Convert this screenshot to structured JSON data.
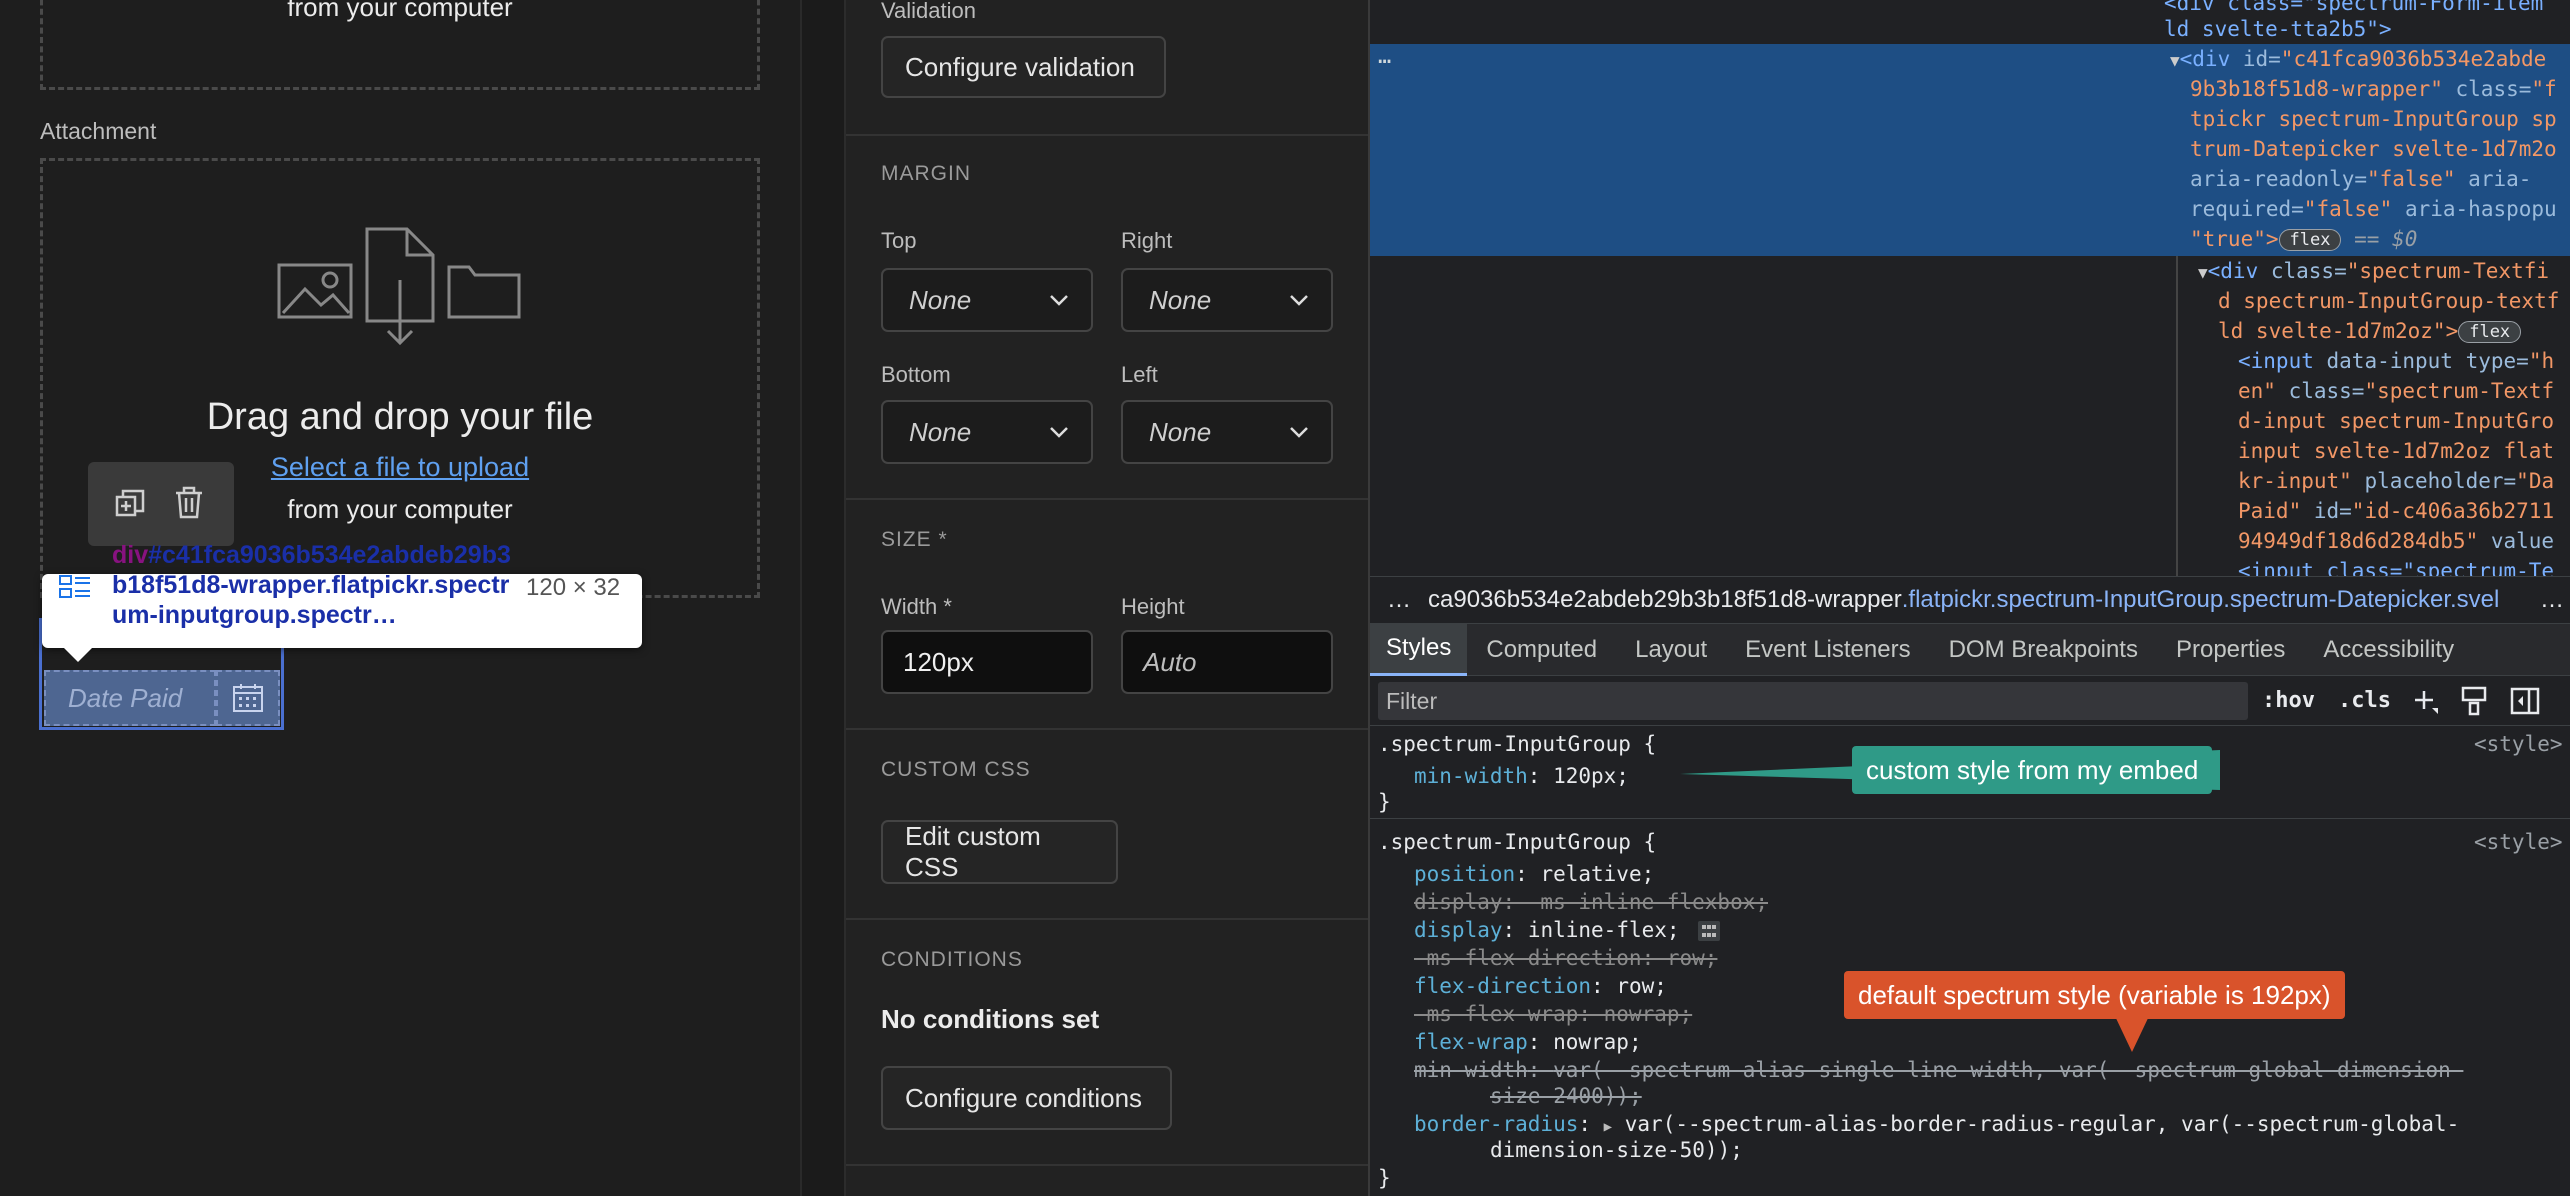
{
  "canvas": {
    "upload_top": {
      "from_computer": "from your computer"
    },
    "attachment_label": "Attachment",
    "upload": {
      "title": "Drag and drop your file",
      "link": "Select a file to upload",
      "from_computer": "from your computer"
    },
    "tooltip": {
      "tag": "div",
      "selector": "#c41fca9036b534e2abdeb29b3b18f51d8-wrapper.flatpickr.spectrum-inputgroup.spectr…",
      "size": "120 × 32"
    },
    "date_field": {
      "placeholder": "Date Paid"
    }
  },
  "settings": {
    "validation": {
      "label": "Validation",
      "button": "Configure validation"
    },
    "margin": {
      "heading": "MARGIN",
      "top": {
        "label": "Top",
        "value": "None"
      },
      "right": {
        "label": "Right",
        "value": "None"
      },
      "bottom": {
        "label": "Bottom",
        "value": "None"
      },
      "left": {
        "label": "Left",
        "value": "None"
      }
    },
    "size": {
      "heading": "SIZE *",
      "width": {
        "label": "Width *",
        "value": "120px"
      },
      "height": {
        "label": "Height",
        "placeholder": "Auto"
      }
    },
    "custom_css": {
      "heading": "CUSTOM CSS",
      "button": "Edit custom CSS"
    },
    "conditions": {
      "heading": "CONDITIONS",
      "status": "No conditions set",
      "button": "Configure conditions"
    }
  },
  "devtools": {
    "dom": {
      "l0a": "<div class=\"spectrum-Form-item",
      "l0b": "ld svelte-tta2b5\">",
      "ellipsis": "…",
      "l1_tag": "<div ",
      "l1_attr": "id=",
      "l1_val": "\"c41fca9036b534e2abde",
      "l2_val": "9b3b18f51d8-wrapper\"",
      "l2_attr": " class=",
      "l2_val2": "\"f",
      "l3": "tpickr spectrum-InputGroup sp",
      "l4": "trum-Datepicker svelte-1d7m2o",
      "l5_attr": "aria-readonly=",
      "l5_val": "\"false\"",
      "l5_attr2": " aria-",
      "l6_attr": "required=",
      "l6_val": "\"false\"",
      "l6_attr2": " aria-haspopu",
      "l7_val": "\"true\">",
      "l7_badge": "flex",
      "l7_sel": "== $0",
      "l8_tag": "<div ",
      "l8_attr": "class=",
      "l8_val": "\"spectrum-Textfi",
      "l9": "d spectrum-InputGroup-textf",
      "l10": "ld svelte-1d7m2oz\">",
      "l10_badge": "flex",
      "l11_tag": "<input ",
      "l11_attr": "data-input type=",
      "l11_val": "\"h",
      "l12_val": "en\"",
      "l12_attr": " class=",
      "l12_val2": "\"spectrum-Textf",
      "l13": "d-input spectrum-InputGro",
      "l14": "input svelte-1d7m2oz flat",
      "l15_val": "kr-input\"",
      "l15_attr": " placeholder=",
      "l15_val2": "\"Da",
      "l16_val": "Paid\"",
      "l16_attr": " id=",
      "l16_val2": "\"id-c406a36b2711",
      "l17_val": "94949df18d6d284db5\"",
      "l17_attr": " value",
      "l18": "<input class=\"spectrum-Te"
    },
    "breadcrumb": {
      "dots": "…",
      "id": "ca9036b534e2abdeb29b3b18f51d8-wrapper",
      "classes": ".flatpickr.spectrum-InputGroup.spectrum-Datepicker.svel",
      "more": "…"
    },
    "tabs": [
      "Styles",
      "Computed",
      "Layout",
      "Event Listeners",
      "DOM Breakpoints",
      "Properties",
      "Accessibility"
    ],
    "filter": {
      "placeholder": "Filter",
      "hov": ":hov",
      "cls": ".cls"
    },
    "rule1": {
      "selector": ".spectrum-InputGroup {",
      "source": "<style>",
      "prop": "min-width",
      "value": "120px;",
      "close": "}"
    },
    "rule2": {
      "selector": ".spectrum-InputGroup {",
      "source": "<style>",
      "d1p": "position",
      "d1v": "relative;",
      "d2": "display: -ms-inline-flexbox;",
      "d3p": "display",
      "d3v": "inline-flex;",
      "d4": "-ms-flex-direction: row;",
      "d5p": "flex-direction",
      "d5v": "row;",
      "d6": "-ms-flex-wrap: nowrap;",
      "d7p": "flex-wrap",
      "d7v": "nowrap;",
      "d8p": "min-width",
      "d8v": "var(--spectrum-alias-single-line-width, var(--spectrum-global-dimension-",
      "d8v2": "size-2400));",
      "d9p": "border-radius",
      "d9v": "var(--spectrum-alias-border-radius-regular, var(--spectrum-global-",
      "d9v2": "dimension-size-50));",
      "close": "}"
    },
    "callouts": {
      "custom": "custom style from my embed",
      "default": "default spectrum style (variable is 192px)"
    }
  },
  "colors": {
    "callout_teal": "#2f9a87",
    "callout_red": "#d9532b",
    "selection": "#1e4e84",
    "link": "#5fa0f0"
  }
}
